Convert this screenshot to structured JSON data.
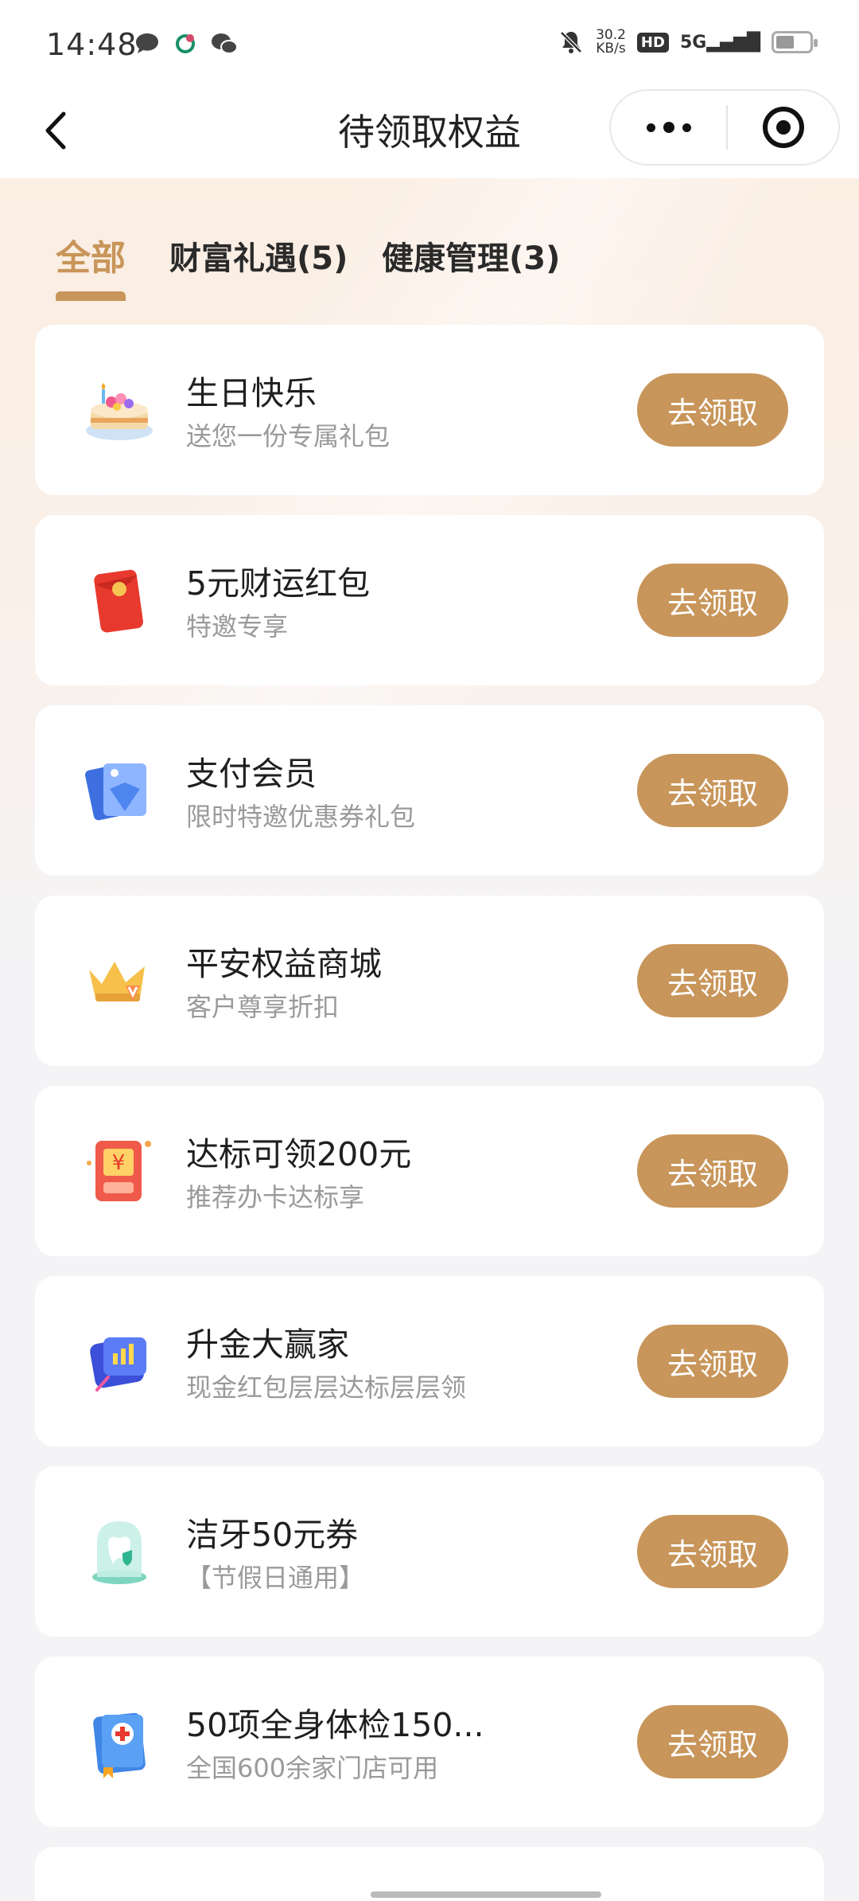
{
  "status_bar": {
    "time": "14:48",
    "net_speed_value": "30.2",
    "net_speed_unit": "KB/s",
    "hd_label": "HD",
    "signal_label": "5G"
  },
  "nav": {
    "title": "待领取权益"
  },
  "tabs": [
    {
      "label": "全部",
      "active": true
    },
    {
      "label": "财富礼遇(5)",
      "active": false
    },
    {
      "label": "健康管理(3)",
      "active": false
    }
  ],
  "accent_color": "#c8955a",
  "benefits": [
    {
      "title": "生日快乐",
      "subtitle": "送您一份专属礼包",
      "button": "去领取",
      "icon": "birthday-cake-icon"
    },
    {
      "title": "5元财运红包",
      "subtitle": "特邀专享",
      "button": "去领取",
      "icon": "red-envelope-icon"
    },
    {
      "title": "支付会员",
      "subtitle": "限时特邀优惠券礼包",
      "button": "去领取",
      "icon": "member-card-icon"
    },
    {
      "title": "平安权益商城",
      "subtitle": "客户尊享折扣",
      "button": "去领取",
      "icon": "crown-icon"
    },
    {
      "title": "达标可领200元",
      "subtitle": "推荐办卡达标享",
      "button": "去领取",
      "icon": "yuan-reward-icon"
    },
    {
      "title": "升金大赢家",
      "subtitle": "现金红包层层达标层层领",
      "button": "去领取",
      "icon": "gold-card-icon"
    },
    {
      "title": "洁牙50元券",
      "subtitle": "【节假日通用】",
      "button": "去领取",
      "icon": "tooth-dome-icon"
    },
    {
      "title": "50项全身体检150...",
      "subtitle": "全国600余家门店可用",
      "button": "去领取",
      "icon": "medical-book-icon"
    }
  ]
}
